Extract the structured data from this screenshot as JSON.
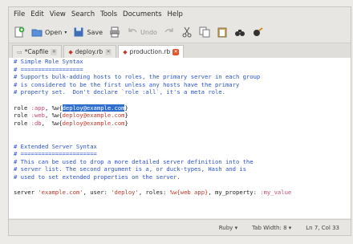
{
  "menu": [
    "File",
    "Edit",
    "View",
    "Search",
    "Tools",
    "Documents",
    "Help"
  ],
  "toolbar": {
    "open_label": "Open",
    "save_label": "Save",
    "undo_label": "Undo"
  },
  "tabs": [
    {
      "label": "*Capfile",
      "active": false
    },
    {
      "label": "deploy.rb",
      "active": false
    },
    {
      "label": "production.rb",
      "active": true
    }
  ],
  "editor": {
    "l1": "# Simple Role Syntax",
    "l2": "# ==================",
    "l3": "# Supports bulk-adding hosts to roles, the primary server in each group",
    "l4": "# is considered to be the first unless any hosts have the primary",
    "l5": "# property set.  Don't declare `role :all`, it's a meta role.",
    "role1_kw": "role ",
    "role1_sym": ":app",
    "role1_mid": ", %w{",
    "role1_host": "deploy@example.com",
    "role1_end": "}",
    "role2_kw": "role ",
    "role2_sym": ":web",
    "role2_mid": ", %w{",
    "role2_host": "deploy@example.com",
    "role2_end": "}",
    "role3_kw": "role ",
    "role3_sym": ":db",
    "role3_mid": ",  %w{",
    "role3_host": "deploy@example.com",
    "role3_end": "}",
    "e1": "# Extended Server Syntax",
    "e2": "# ======================",
    "e3": "# This can be used to drop a more detailed server definition into the",
    "e4": "# server list. The second argument is a, or duck-types, Hash and is",
    "e5": "# used to set extended properties on the server.",
    "srv_kw": "server ",
    "srv_str": "'example.com'",
    "srv_a": ", user: ",
    "srv_user": "'deploy'",
    "srv_b": ", roles: ",
    "srv_roles": "%w{web app}",
    "srv_c": ", my_property: ",
    "srv_prop": ":my_value"
  },
  "status": {
    "language": "Ruby",
    "tab_width": "Tab Width: 8",
    "position": "Ln 7, Col 33"
  },
  "colors": {
    "comment": "#2b53c9",
    "string": "#c0392b",
    "selection": "#2f6fd0"
  }
}
